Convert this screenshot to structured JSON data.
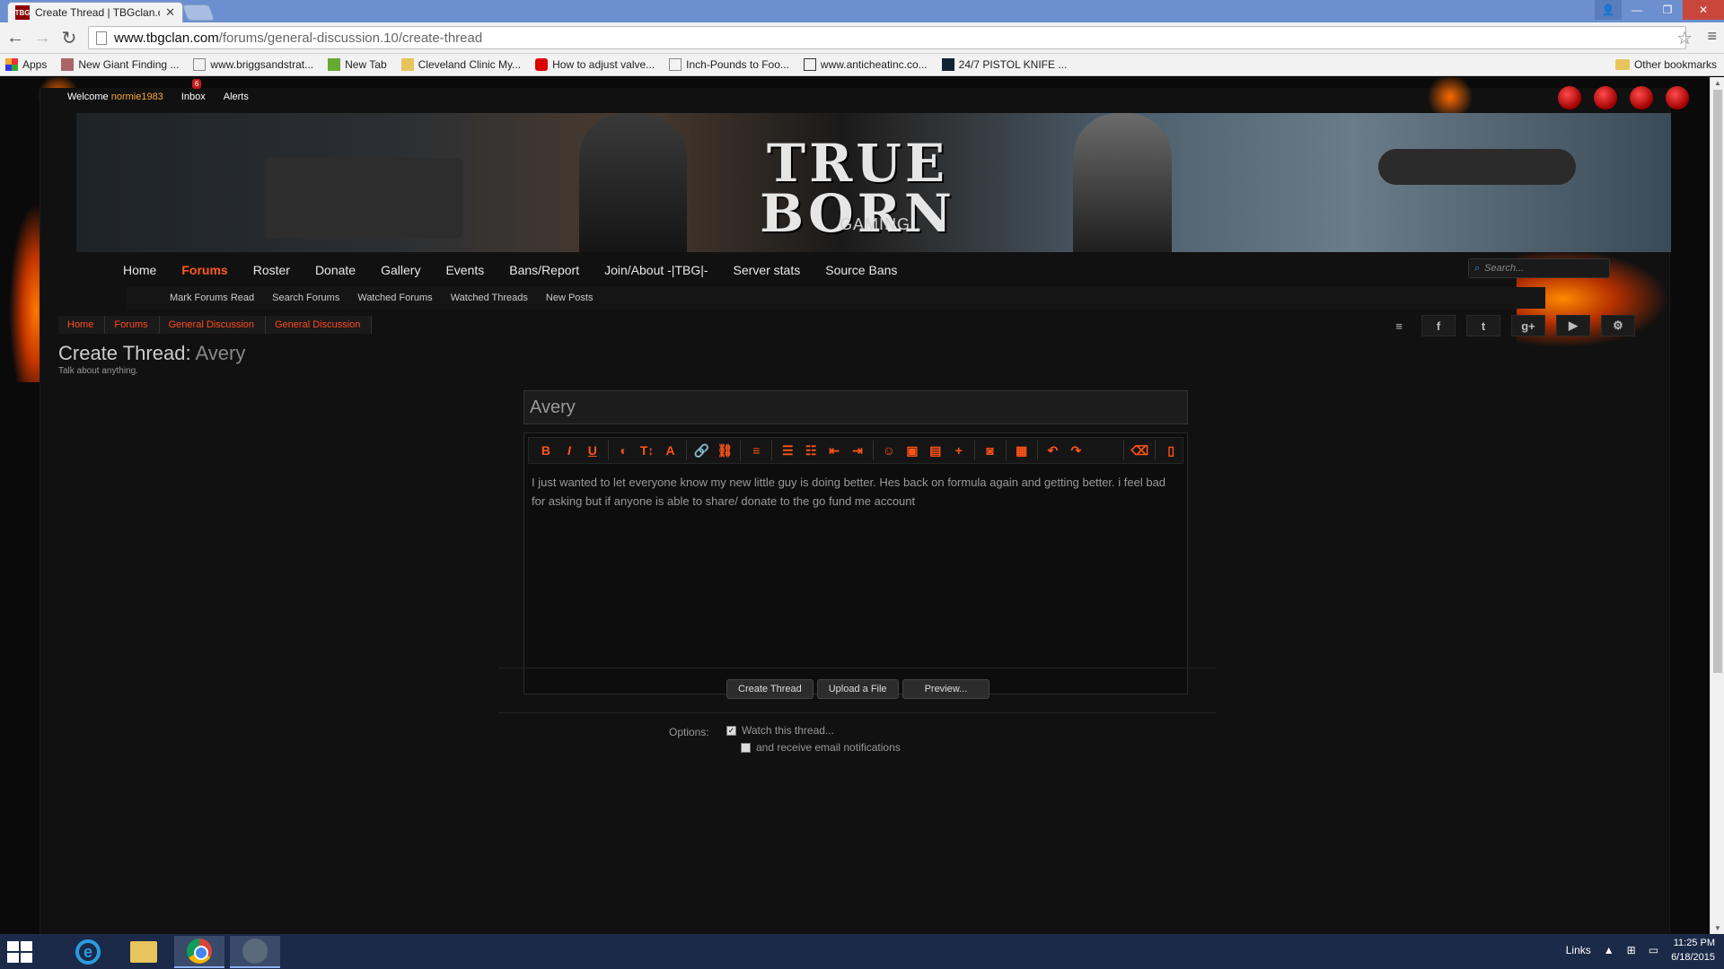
{
  "browser": {
    "tab_title": "Create Thread | TBGclan.c",
    "tab_icon": "TBG",
    "url_domain": "www.tbgclan.com",
    "url_path": "/forums/general-discussion.10/create-thread",
    "bookmarks": [
      "Apps",
      "New Giant Finding ...",
      "www.briggsandstrat...",
      "New Tab",
      "Cleveland Clinic My...",
      "How to adjust valve...",
      "Inch-Pounds to Foo...",
      "www.anticheatinc.co...",
      "24/7 PISTOL KNIFE ..."
    ],
    "other_bookmarks": "Other bookmarks"
  },
  "site": {
    "welcome": "Welcome",
    "username": "normie1983",
    "inbox": "Inbox",
    "inbox_count": "6",
    "alerts": "Alerts",
    "logo_main": "TRUE BORN",
    "logo_sub": "GAMING",
    "nav": [
      "Home",
      "Forums",
      "Roster",
      "Donate",
      "Gallery",
      "Events",
      "Bans/Report",
      "Join/About -|TBG|-",
      "Server stats",
      "Source Bans"
    ],
    "search_placeholder": "Search...",
    "subnav": [
      "Mark Forums Read",
      "Search Forums",
      "Watched Forums",
      "Watched Threads",
      "New Posts"
    ],
    "breadcrumbs": [
      "Home",
      "Forums",
      "General Discussion",
      "General Discussion"
    ]
  },
  "form": {
    "heading_prefix": "Create Thread:",
    "heading_name": "Avery",
    "description": "Talk about anything.",
    "title_value": "Avery",
    "message": "I just wanted to let everyone know my new little guy is doing better. Hes back on formula again and getting better. i feel bad  for asking but if anyone is able to share/ donate to the go fund me account",
    "buttons": [
      "Create Thread",
      "Upload a File",
      "Preview..."
    ],
    "options_label": "Options:",
    "watch_label": "Watch this thread...",
    "email_label": "and receive email notifications",
    "watch_checked": true,
    "email_checked": false
  },
  "taskbar": {
    "links": "Links",
    "time": "11:25 PM",
    "date": "6/18/2015"
  }
}
